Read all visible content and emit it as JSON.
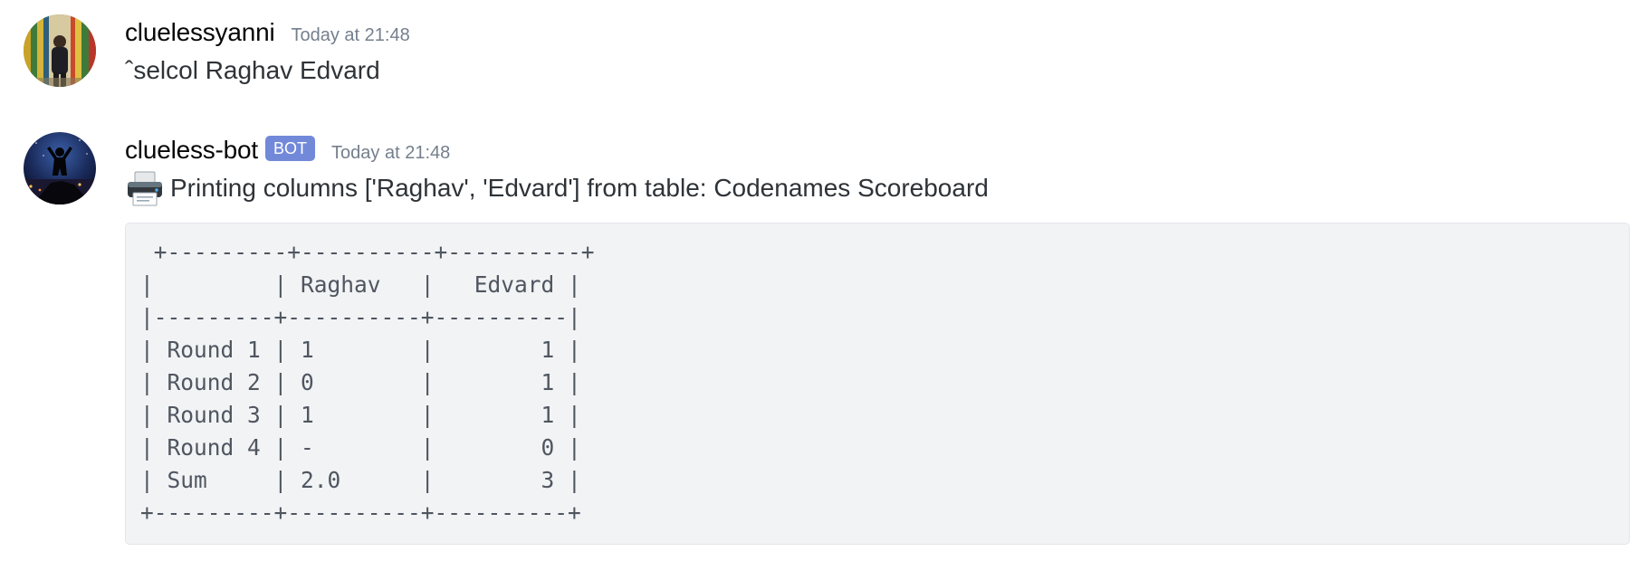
{
  "messages": [
    {
      "author": "cluelessyanni",
      "timestamp": "Today at 21:48",
      "content": "ˆselcol Raghav Edvard",
      "is_bot": false
    },
    {
      "author": "clueless-bot",
      "bot_tag": "BOT",
      "timestamp": "Today at 21:48",
      "content": "Printing columns ['Raghav', 'Edvard'] from table: Codenames Scoreboard",
      "content_icon": "printer-icon",
      "is_bot": true,
      "code_block": {
        "lines": [
          " +---------+----------+----------+",
          "|         | Raghav   |   Edvard |",
          "|---------+----------+----------|",
          "| Round 1 | 1        |        1 |",
          "| Round 2 | 0        |        1 |",
          "| Round 3 | 1        |        1 |",
          "| Round 4 | -        |        0 |",
          "| Sum     | 2.0      |        3 |",
          "+---------+----------+----------+"
        ]
      }
    }
  ],
  "colors": {
    "bot_tag": "#7289da",
    "timestamp": "#747f8d",
    "code_background": "#f2f3f5"
  }
}
